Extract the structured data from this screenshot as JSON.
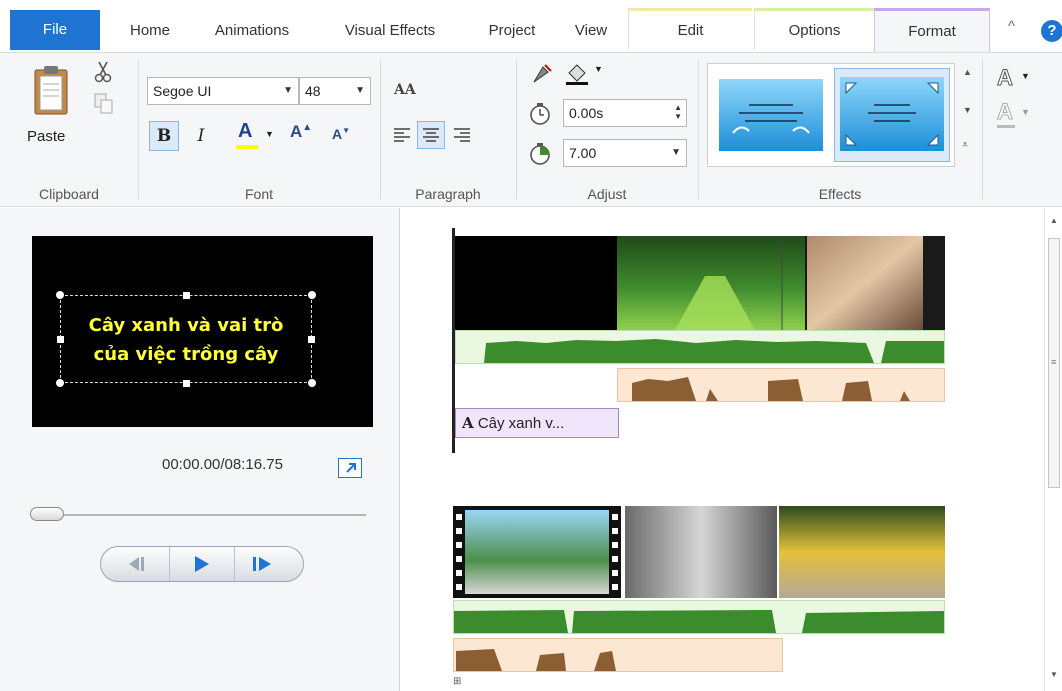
{
  "tabs": {
    "file": "File",
    "home": "Home",
    "animations": "Animations",
    "visual_effects": "Visual Effects",
    "project": "Project",
    "view": "View",
    "edit": "Edit",
    "options": "Options",
    "format": "Format",
    "collapse": "^",
    "help": "?"
  },
  "clipboard": {
    "paste": "Paste",
    "group": "Clipboard"
  },
  "font": {
    "family": "Segoe UI",
    "size": "48",
    "bold": "B",
    "italic": "I",
    "color": "A",
    "grow": "A",
    "shrink": "A",
    "group": "Font"
  },
  "paragraph": {
    "group": "Paragraph",
    "font_size_icon": "AA"
  },
  "adjust": {
    "start_time": "0.00s",
    "duration": "7.00",
    "group": "Adjust"
  },
  "effects": {
    "group": "Effects"
  },
  "preview": {
    "caption_line1": "Cây xanh và vai trò",
    "caption_line2": "của việc trồng cây",
    "time": "00:00.00/08:16.75"
  },
  "storyboard": {
    "title_clip": "Cây xanh v..."
  },
  "colors": {
    "accent": "#1e73d3",
    "caption": "#ffff3b",
    "audio_wave": "#3a8c2c",
    "music_wave": "#8b5e34",
    "title_clip": "#f1e5fb"
  }
}
